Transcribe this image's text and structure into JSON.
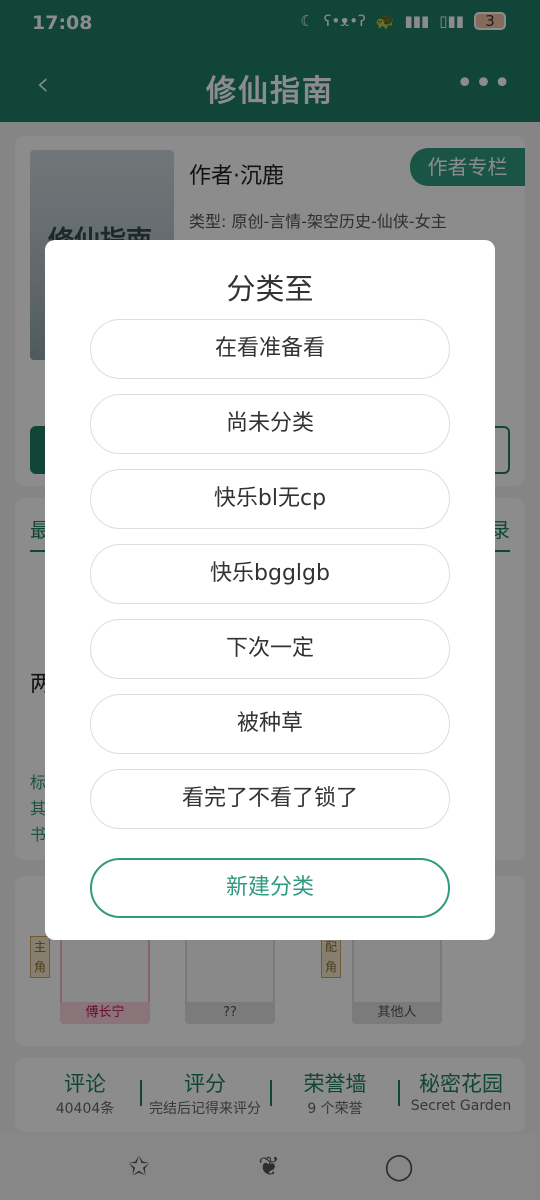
{
  "status_bar": {
    "time": "17:08",
    "battery_level": "3"
  },
  "header": {
    "title": "修仙指南"
  },
  "book": {
    "cover_title": "修仙指南",
    "author": "作者·沉鹿",
    "author_column": "作者专栏",
    "genre": "类型: 原创-言情-架空历史-仙侠-女主"
  },
  "chapters_fragment": {
    "left_tab": "最",
    "right_tab": "录",
    "left_char": "两",
    "tags": [
      "标",
      "其",
      "书"
    ]
  },
  "roles": [
    {
      "badge": "主角",
      "name": "傅长宁"
    },
    {
      "badge": "",
      "name": "??"
    },
    {
      "badge": "配角",
      "name": "其他人"
    }
  ],
  "stats": [
    {
      "title": "评论",
      "sub": "40404条"
    },
    {
      "title": "评分",
      "sub": "完结后记得来评分"
    },
    {
      "title": "荣誉墙",
      "sub": "9 个荣誉"
    },
    {
      "title": "秘密花园",
      "sub": "Secret Garden"
    }
  ],
  "dialog": {
    "title": "分类至",
    "options": [
      "在看准备看",
      "尚未分类",
      "快乐bl无cp",
      "快乐bgglgb",
      "下次一定",
      "被种草",
      "看完了不看了锁了"
    ],
    "new_category_label": "新建分类"
  },
  "icons": {
    "back": "back-arrow-icon",
    "more": "more-icon",
    "nav": [
      "star-icon",
      "leaf-icon",
      "bubble-icon"
    ]
  },
  "colors": {
    "primary": "#1f7f67",
    "accent": "#2f9a7f"
  }
}
